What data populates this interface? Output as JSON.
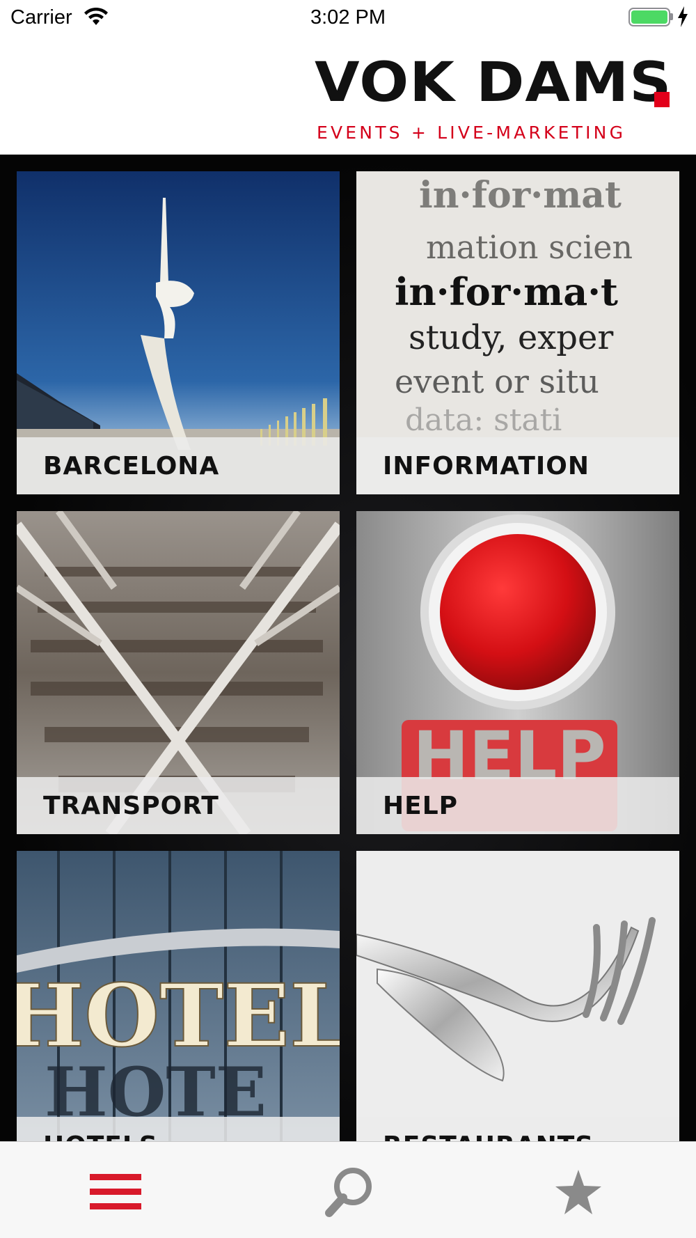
{
  "status_bar": {
    "carrier": "Carrier",
    "time": "3:02 PM",
    "battery_level": 1.0
  },
  "header": {
    "logo_brand": "VOK DAMS",
    "logo_tagline": "EVENTS + LIVE-MARKETING"
  },
  "tiles": [
    {
      "label": "BARCELONA",
      "image": "montjuic-tower-photo"
    },
    {
      "label": "INFORMATION",
      "image": "dictionary-information-photo"
    },
    {
      "label": "TRANSPORT",
      "image": "rail-tracks-photo"
    },
    {
      "label": "HELP",
      "image": "red-help-button-photo"
    },
    {
      "label": "HOTELS",
      "image": "hotel-sign-photo"
    },
    {
      "label": "RESTAURANTS",
      "image": "knife-and-fork-photo"
    }
  ],
  "tab_bar": {
    "items": [
      {
        "name": "menu",
        "icon": "hamburger-icon",
        "active": true
      },
      {
        "name": "search",
        "icon": "search-icon",
        "active": false
      },
      {
        "name": "favorites",
        "icon": "star-icon",
        "active": false
      }
    ]
  },
  "colors": {
    "brand_red": "#e2001a",
    "tab_active": "#d8192a",
    "tab_inactive": "#8a8a8a"
  }
}
